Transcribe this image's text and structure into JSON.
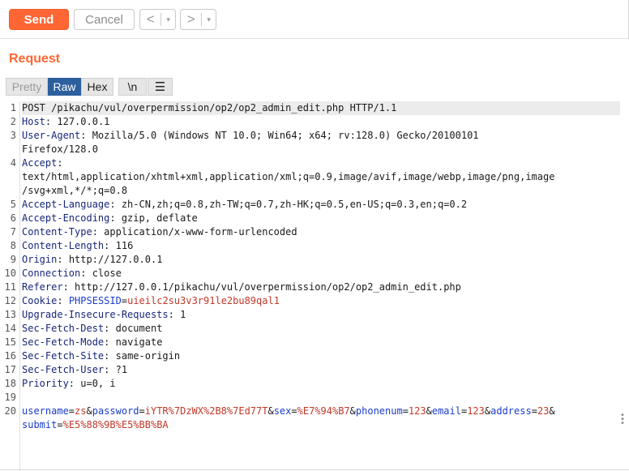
{
  "toolbar": {
    "send_label": "Send",
    "cancel_label": "Cancel",
    "back_arrow": "<",
    "forward_arrow": ">",
    "dropdown_glyph": "▾"
  },
  "request": {
    "title": "Request",
    "view_tabs": [
      "Pretty",
      "Raw",
      "Hex"
    ],
    "selected_tab": "Raw",
    "newline_label": "\\n",
    "menu_icon": "hamburger-icon"
  },
  "editor": {
    "line_numbers": [
      "1",
      "2",
      "3",
      "",
      "4",
      "",
      "",
      "5",
      "6",
      "7",
      "8",
      "9",
      "10",
      "11",
      "12",
      "13",
      "14",
      "15",
      "16",
      "17",
      "18",
      "19",
      "20",
      ""
    ],
    "lines": [
      {
        "text": "POST /pikachu/vul/overpermission/op2/op2_admin_edit.php HTTP/1.1"
      },
      {
        "key": "Host",
        "value": " 127.0.0.1"
      },
      {
        "key": "User-Agent",
        "value": " Mozilla/5.0 (Windows NT 10.0; Win64; x64; rv:128.0) Gecko/20100101"
      },
      {
        "text": "Firefox/128.0"
      },
      {
        "key": "Accept",
        "value": ""
      },
      {
        "text": "text/html,application/xhtml+xml,application/xml;q=0.9,image/avif,image/webp,image/png,image"
      },
      {
        "text": "/svg+xml,*/*;q=0.8"
      },
      {
        "key": "Accept-Language",
        "value": " zh-CN,zh;q=0.8,zh-TW;q=0.7,zh-HK;q=0.5,en-US;q=0.3,en;q=0.2"
      },
      {
        "key": "Accept-Encoding",
        "value": " gzip, deflate"
      },
      {
        "key": "Content-Type",
        "value": " application/x-www-form-urlencoded"
      },
      {
        "key": "Content-Length",
        "value": " 116"
      },
      {
        "key": "Origin",
        "value": " http://127.0.0.1"
      },
      {
        "key": "Connection",
        "value": " close"
      },
      {
        "key": "Referer",
        "value": " http://127.0.0.1/pikachu/vul/overpermission/op2/op2_admin_edit.php"
      },
      {
        "key": "Cookie",
        "cookie_name": "PHPSESSID",
        "cookie_value": "uieilc2su3v3r91le2bu89qal1"
      },
      {
        "key": "Upgrade-Insecure-Requests",
        "value": " 1"
      },
      {
        "key": "Sec-Fetch-Dest",
        "value": " document"
      },
      {
        "key": "Sec-Fetch-Mode",
        "value": " navigate"
      },
      {
        "key": "Sec-Fetch-Site",
        "value": " same-origin"
      },
      {
        "key": "Sec-Fetch-User",
        "value": " ?1"
      },
      {
        "key": "Priority",
        "value": " u=0, i"
      },
      {
        "text": ""
      }
    ],
    "body_params": [
      {
        "name": "username",
        "value": "zs"
      },
      {
        "name": "password",
        "value": "iYTR%7DzWX%2B8%7Ed77T"
      },
      {
        "name": "sex",
        "value": "%E7%94%B7"
      },
      {
        "name": "phonenum",
        "value": "123"
      },
      {
        "name": "email",
        "value": "123"
      },
      {
        "name": "address",
        "value": "23"
      },
      {
        "name": "submit",
        "value": "%E5%88%9B%E5%BB%BA"
      }
    ]
  },
  "colors": {
    "accent": "#ff6633",
    "selected_tab": "#2c5f9e",
    "header_key": "#17277a",
    "param_name": "#1a3ccc",
    "param_value": "#c0392b"
  }
}
